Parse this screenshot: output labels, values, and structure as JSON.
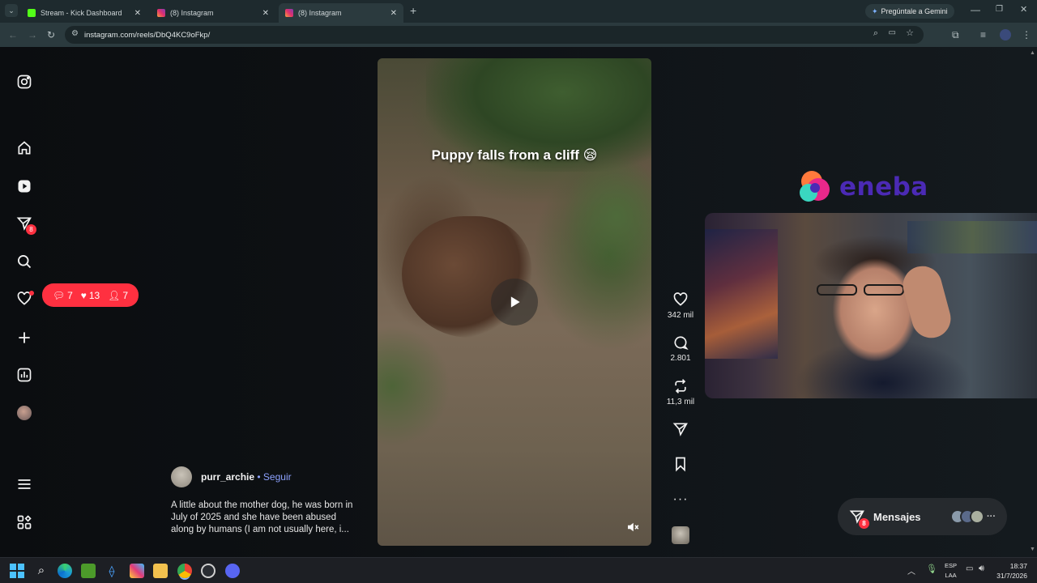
{
  "browser": {
    "tabs": [
      {
        "title": "Stream - Kick Dashboard",
        "active": false,
        "favicon_color": "#53fc18"
      },
      {
        "title": "(8) Instagram",
        "active": false,
        "favicon_color": "#e1306c"
      },
      {
        "title": "(8) Instagram",
        "active": true,
        "favicon_color": "#e1306c"
      }
    ],
    "new_tab_label": "+",
    "gemini_button": "Pregúntale a Gemini",
    "url": "instagram.com/reels/DbQ4KC9oFkp/"
  },
  "sidebar": {
    "notifications_badge": "8",
    "activity": {
      "comments": "7",
      "likes": "13",
      "followers": "7"
    }
  },
  "reel": {
    "caption": "Puppy falls from a cliff 😪",
    "author": "purr_archie",
    "follow_label": "Seguir",
    "separator": "•",
    "description": "A little about the mother dog, he was born in July of 2025 and she have been abused along by humans (I am not usually here, i...",
    "likes": "342 mil",
    "comments": "2.801",
    "reposts": "11,3 mil"
  },
  "overlay": {
    "sponsor": "eneba"
  },
  "messages": {
    "label": "Mensajes",
    "badge": "8"
  },
  "taskbar": {
    "lang_top": "ESP",
    "lang_bottom": "LAA",
    "time": "18:37",
    "date": "31/7/2026"
  },
  "colors": {
    "accent_red": "#ff3040",
    "follow_blue": "#8da2ff",
    "eneba_purple": "#4b2ab5"
  }
}
